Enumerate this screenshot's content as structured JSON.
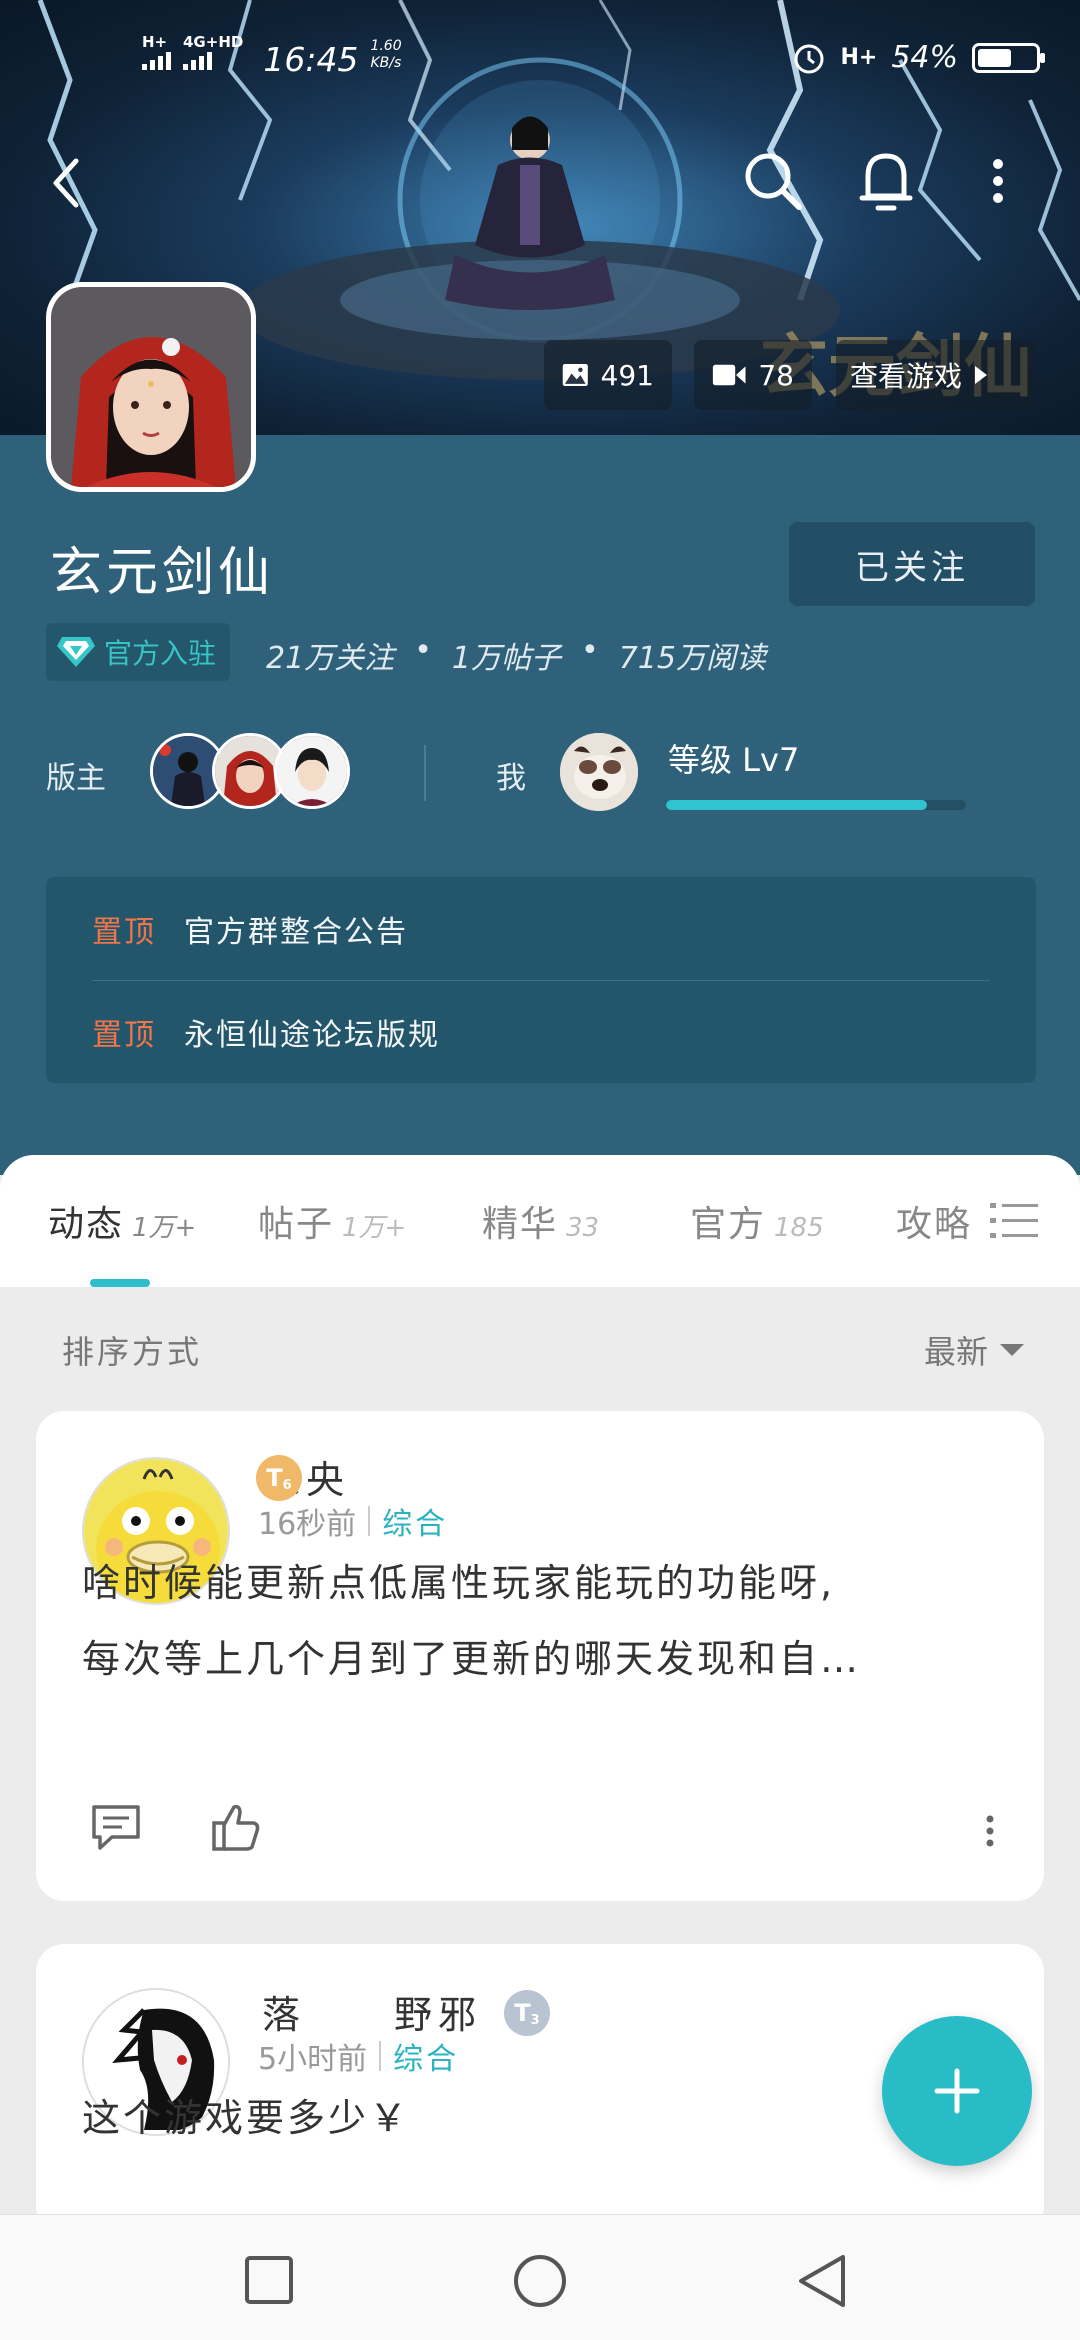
{
  "status_bar": {
    "network_1": "H+",
    "network_2": "4G+HD",
    "time": "16:45",
    "speed_value": "1.60",
    "speed_unit": "KB/s",
    "network_right": "H+",
    "battery_percent_text": "54%",
    "battery_level": 0.54
  },
  "banner": {
    "images_count": "491",
    "videos_count": "78",
    "view_game_label": "查看游戏"
  },
  "header": {
    "game_name": "玄元剑仙",
    "follow_label": "已关注",
    "official_badge": "官方入驻",
    "followers": "21万关注",
    "posts": "1万帖子",
    "reads": "715万阅读",
    "dot": "•",
    "moderators_label": "版主",
    "me_label": "我",
    "level_text": "等级 Lv7",
    "level_progress": 0.87
  },
  "pinned": [
    {
      "tag": "置顶",
      "text": "官方群整合公告"
    },
    {
      "tag": "置顶",
      "text": "永恒仙途论坛版规"
    }
  ],
  "tabs": [
    {
      "label": "动态",
      "count": "1万+"
    },
    {
      "label": "帖子",
      "count": "1万+"
    },
    {
      "label": "精华",
      "count": "33"
    },
    {
      "label": "官方",
      "count": "185"
    },
    {
      "label": "攻略",
      "count": ""
    }
  ],
  "sort": {
    "label": "排序方式",
    "value": "最新"
  },
  "posts": [
    {
      "username": "未央",
      "level_badge": "T",
      "level_sub": "6",
      "time": "16秒前",
      "category": "综合",
      "content_line1": "啥时候能更新点低属性玩家能玩的功能呀,",
      "content_line2": "每次等上几个月到了更新的哪天发现和自…"
    },
    {
      "username": "落　　野邪",
      "level_badge": "T",
      "level_sub": "3",
      "time": "5小时前",
      "category": "综合",
      "content_line1": "这个游戏要多少￥"
    }
  ],
  "colors": {
    "panel": "#2f627a",
    "accent": "#27bcc6",
    "pin_tag": "#f0764a"
  }
}
